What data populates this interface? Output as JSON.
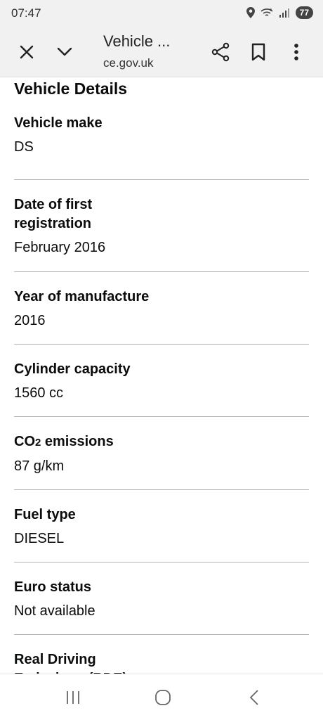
{
  "status_bar": {
    "time": "07:47",
    "battery": "77"
  },
  "toolbar": {
    "title": "Vehicle ...",
    "url": "ce.gov.uk"
  },
  "page": {
    "heading": "Vehicle Details",
    "rows": [
      {
        "label": "Vehicle make",
        "value": "DS"
      },
      {
        "label": "Date of first registration",
        "value": "February 2016"
      },
      {
        "label": "Year of manufacture",
        "value": "2016"
      },
      {
        "label": "Cylinder capacity",
        "value": "1560 cc"
      },
      {
        "label": "CO",
        "label_sub": "2",
        "label_suffix": " emissions",
        "value": "87 g/km"
      },
      {
        "label": "Fuel type",
        "value": "DIESEL"
      },
      {
        "label": "Euro status",
        "value": "Not available"
      },
      {
        "label": "Real Driving Emissions (RDE)",
        "value": ""
      }
    ]
  },
  "icons": {
    "close": "close-icon",
    "chevron": "chevron-down-icon",
    "share": "share-icon",
    "bookmark": "bookmark-icon",
    "menu": "more-vert-icon"
  }
}
